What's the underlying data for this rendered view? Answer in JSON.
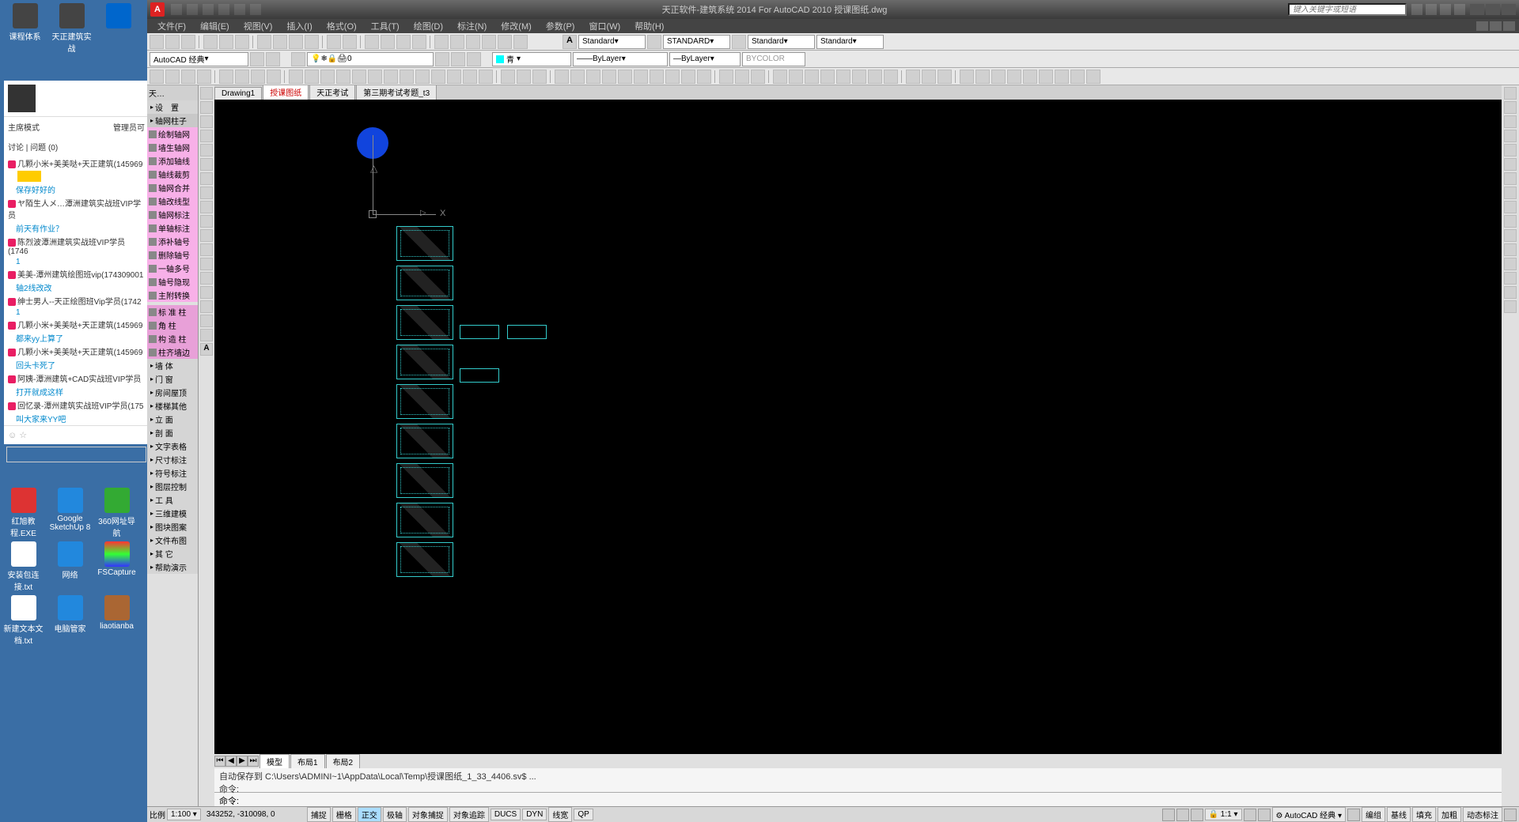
{
  "desktop": {
    "icons": [
      "课程体系",
      "天正建筑实战",
      "…",
      "",
      "红旭教程.EXE",
      "Google SketchUp 8",
      "360网址导航",
      "安装包连接.txt",
      "网络",
      "FSCapture",
      "新建文本文档.txt",
      "电脑管家",
      "liaotianba"
    ]
  },
  "chat": {
    "mode_label": "主席模式",
    "admin_text": "管理员可",
    "tab_discuss": "讨论",
    "tab_question": "问题",
    "tab_count": "(0)",
    "items": [
      {
        "p1": "几颗小米+美美哒+天正建筑(145969",
        "p2": ""
      },
      {
        "p1": "",
        "p2": "保存好好的"
      },
      {
        "p1": "ヤ陌生人メ…潭洲建筑实战班VIP学员",
        "p2": "前天有作业？"
      },
      {
        "p1": "陈烈波潭洲建筑实战班VIP学员(1746",
        "p2": "1"
      },
      {
        "p1": "美美-潭州建筑绘图班vip(174309001",
        "p2": "轴2线改改"
      },
      {
        "p1": "绅士男人--天正绘图班Vip学员(1742",
        "p2": "1"
      },
      {
        "p1": "几颗小米+美美哒+天正建筑(145969",
        "p2": "都来yy上算了"
      },
      {
        "p1": "几颗小米+美美哒+天正建筑(145969",
        "p2": "回头卡死了"
      },
      {
        "p1": "阿姨-潭洲建筑+CAD实战班VIP学员",
        "p2": "打开就成这样"
      },
      {
        "p1": "回忆录-潭州建筑实战班VIP学员(175",
        "p2": "叫大家来YY吧"
      }
    ]
  },
  "cad": {
    "title": "天正软件-建筑系统 2014  For AutoCAD 2010   授课图纸.dwg",
    "search_placeholder": "键入关键字或短语",
    "menus": [
      "文件(F)",
      "编辑(E)",
      "视图(V)",
      "插入(I)",
      "格式(O)",
      "工具(T)",
      "绘图(D)",
      "标注(N)",
      "修改(M)",
      "参数(P)",
      "窗口(W)",
      "帮助(H)"
    ],
    "styles": {
      "text": "Standard",
      "dim": "STANDARD",
      "table": "Standard",
      "mleader": "Standard"
    },
    "workspace": "AutoCAD 经典",
    "layer_current": "0",
    "color": "青",
    "linetype": "ByLayer",
    "lineweight": "ByLayer",
    "plotcolor": "BYCOLOR",
    "file_tabs": [
      "Drawing1",
      "授课图纸",
      "天正考试",
      "第三期考试考题_t3"
    ],
    "active_tab": 1,
    "tz_panel": {
      "title": "天…",
      "header": [
        "设",
        "置"
      ],
      "axis_section": "轴网柱子",
      "axis_items": [
        "绘制轴网",
        "墙生轴网",
        "添加轴线",
        "轴线裁剪",
        "轴网合并",
        "轴改线型",
        "轴网标注",
        "单轴标注",
        "添补轴号",
        "删除轴号",
        "一轴多号",
        "轴号隐现",
        "主附转换"
      ],
      "axis_std": [
        "标 准 柱",
        "角   柱",
        "构 造 柱",
        "柱齐墙边"
      ],
      "sections": [
        "墙   体",
        "门   窗",
        "房间屋顶",
        "楼梯其他",
        "立   面",
        "剖   面",
        "文字表格",
        "尺寸标注",
        "符号标注",
        "图层控制",
        "工   具",
        "三维建模",
        "图块图案",
        "文件布图",
        "其   它",
        "帮助演示"
      ]
    },
    "layout_tabs": {
      "model": "模型",
      "layouts": [
        "布局1",
        "布局2"
      ]
    },
    "cmd": {
      "history": "自动保存到 C:\\Users\\ADMINI~1\\AppData\\Local\\Temp\\授课图纸_1_33_4406.sv$ ...",
      "prompt1": "命令:",
      "prompt2": "命令:"
    },
    "status": {
      "scale_label": "比例",
      "scale_val": "1:100",
      "coords": "343252, -310098, 0",
      "toggles": [
        "捕捉",
        "栅格",
        "正交",
        "极轴",
        "对象捕捉",
        "对象追踪",
        "DUCS",
        "DYN",
        "线宽",
        "QP"
      ],
      "active_toggles": [
        2
      ],
      "anno_scale": "1:1",
      "workspace_sb": "AutoCAD 经典",
      "right_toggles": [
        "编组",
        "基线",
        "填充",
        "加粗",
        "动态标注"
      ]
    }
  }
}
